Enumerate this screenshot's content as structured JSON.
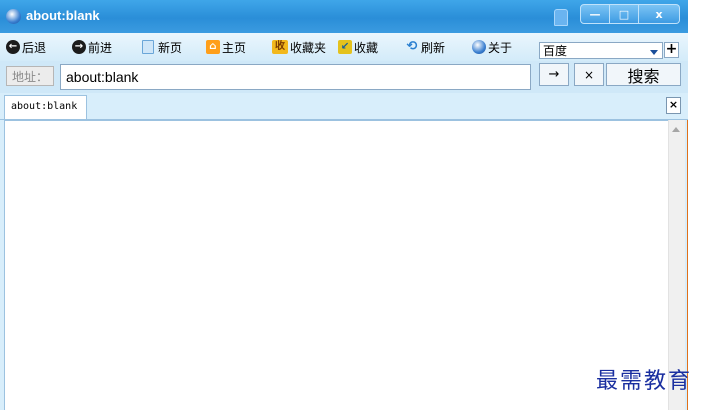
{
  "window": {
    "title": "about:blank",
    "controls": {
      "minimize": "—",
      "maximize": "□",
      "close": "x"
    }
  },
  "toolbar": {
    "items": [
      {
        "label": "后退",
        "icon": "back-arrow-icon"
      },
      {
        "label": "前进",
        "icon": "forward-arrow-icon"
      },
      {
        "label": "新页",
        "icon": "new-page-icon"
      },
      {
        "label": "主页",
        "icon": "home-icon"
      },
      {
        "label": "收藏夹",
        "icon": "favorites-icon",
        "icon_text": "收"
      },
      {
        "label": "收藏",
        "icon": "add-favorite-icon"
      },
      {
        "label": "刷新",
        "icon": "refresh-icon"
      },
      {
        "label": "关于",
        "icon": "about-icon"
      }
    ],
    "search_engine": {
      "selected": "百度",
      "add_label": "+"
    }
  },
  "address_bar": {
    "label": "地址：",
    "value": "about:blank",
    "go_label": "→",
    "stop_label": "×",
    "search_label": "搜索"
  },
  "tabs": [
    {
      "label": "about:blank",
      "active": true
    }
  ],
  "tab_close_label": "×",
  "watermark": "最需教育",
  "colors": {
    "titlebar": "#2a8ed8",
    "chrome": "#d8eefb",
    "window_edge": "#e0701a",
    "watermark": "#1a2fa0"
  }
}
